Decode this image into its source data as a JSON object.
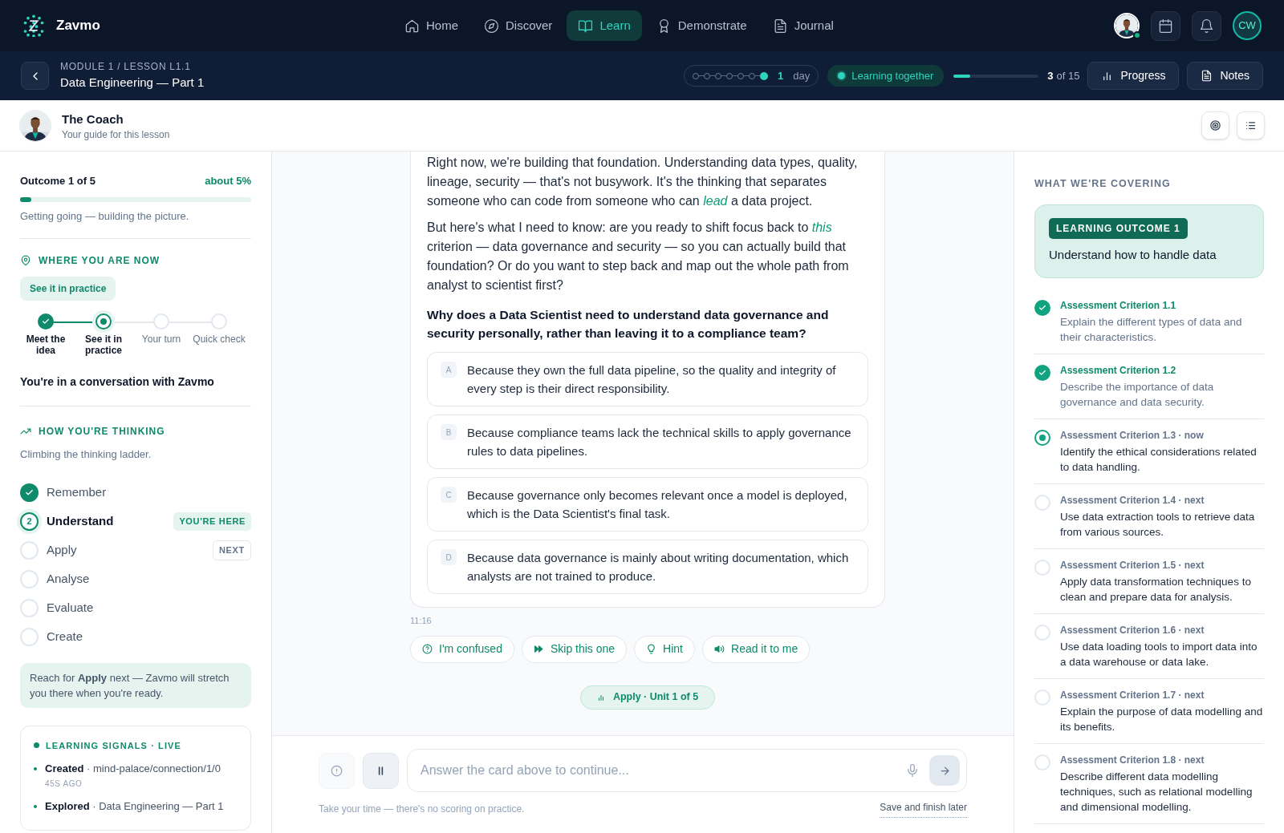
{
  "nav": {
    "brand": "Zavmo",
    "items": [
      {
        "label": "Home",
        "kind": "home",
        "selected": false
      },
      {
        "label": "Discover",
        "kind": "compass",
        "selected": false
      },
      {
        "label": "Learn",
        "kind": "book",
        "selected": true
      },
      {
        "label": "Demonstrate",
        "kind": "award",
        "selected": false
      },
      {
        "label": "Journal",
        "kind": "file",
        "selected": false
      }
    ],
    "online": true,
    "initials": "CW"
  },
  "lesson": {
    "breadcrumb": "MODULE 1 / LESSON L1.1",
    "title": "Data Engineering — Part 1",
    "streak": {
      "days": [
        {
          "active": false
        },
        {
          "active": false
        },
        {
          "active": false
        },
        {
          "active": false
        },
        {
          "active": false
        },
        {
          "active": false
        },
        {
          "active": true
        }
      ],
      "count": "1",
      "unit": "day"
    },
    "mode": "Learning together",
    "progress": {
      "level": 0.2,
      "current": "3",
      "total": "of 15"
    },
    "buttons": [
      {
        "label": "Progress",
        "kind": "bars"
      },
      {
        "label": "Notes",
        "kind": "file"
      }
    ]
  },
  "coach": {
    "name": "The Coach",
    "subtitle": "Your guide for this lesson"
  },
  "left": {
    "outcome": {
      "label": "Outcome 1 of 5",
      "percent": "about 5%",
      "level": 0.05,
      "caption": "Getting going — building the picture."
    },
    "where": {
      "heading": "WHERE YOU ARE NOW",
      "chip": "See it in practice",
      "steps": [
        {
          "label": "Meet the idea",
          "kind": "done"
        },
        {
          "label": "See it in practice",
          "kind": "current"
        },
        {
          "label": "Your turn",
          "kind": "todo"
        },
        {
          "label": "Quick check",
          "kind": "todo"
        }
      ],
      "status": "You're in a conversation with Zavmo"
    },
    "thinking": {
      "heading": "HOW YOU'RE THINKING",
      "caption": "Climbing the thinking ladder.",
      "levels": [
        {
          "label": "Remember",
          "kind": "done"
        },
        {
          "label": "Understand",
          "kind": "current",
          "number": "2",
          "badge": {
            "text": "YOU'RE HERE",
            "kind": "here"
          }
        },
        {
          "label": "Apply",
          "kind": "todo",
          "badge": {
            "text": "NEXT",
            "kind": "next"
          }
        },
        {
          "label": "Analyse",
          "kind": "todo"
        },
        {
          "label": "Evaluate",
          "kind": "todo"
        },
        {
          "label": "Create",
          "kind": "todo"
        }
      ],
      "note": "Reach for **Apply** next — Zavmo will stretch you there when you're ready."
    },
    "signals": {
      "heading": "LEARNING SIGNALS · LIVE",
      "items": [
        {
          "action": "Created",
          "detail": "· mind-palace/connection/1/0",
          "time": "45S AGO"
        },
        {
          "action": "Explored",
          "detail": "· Data Engineering — Part 1"
        }
      ]
    }
  },
  "chat": {
    "paragraphs": [
      "Right now, we're building that foundation. Understanding data types, quality, lineage, security — that's not busywork. It's the thinking that separates someone who can code from someone who can *lead* a data project.",
      "But here's what I need to know: are you ready to shift focus back to *this* criterion — data governance and security — so you can actually build that foundation? Or do you want to step back and map out the whole path from analyst to scientist first?"
    ],
    "question": "Why does a Data Scientist need to understand data governance and security personally, rather than leaving it to a compliance team?",
    "options": [
      {
        "letter": "A",
        "text": "Because they own the full data pipeline, so the quality and integrity of every step is their direct responsibility."
      },
      {
        "letter": "B",
        "text": "Because compliance teams lack the technical skills to apply governance rules to data pipelines."
      },
      {
        "letter": "C",
        "text": "Because governance only becomes relevant once a model is deployed, which is the Data Scientist's final task."
      },
      {
        "letter": "D",
        "text": "Because data governance is mainly about writing documentation, which analysts are not trained to produce."
      }
    ],
    "time": "11:16",
    "actions": [
      {
        "label": "I'm confused",
        "kind": "help"
      },
      {
        "label": "Skip this one",
        "kind": "ff"
      },
      {
        "label": "Hint",
        "kind": "bulb"
      },
      {
        "label": "Read it to me",
        "kind": "speaker"
      }
    ],
    "unit": "Apply · Unit 1 of 5",
    "composer": {
      "placeholder": "Answer the card above to continue...",
      "note": "Take your time — there's no scoring on practice.",
      "save": "Save and finish later"
    }
  },
  "right": {
    "heading": "WHAT WE'RE COVERING",
    "outcome_tag": "LEARNING OUTCOME 1",
    "outcome": "Understand how to handle data",
    "criteria": [
      {
        "title": "Assessment Criterion 1.1",
        "text": "Explain the different types of data and their characteristics.",
        "kind": "done"
      },
      {
        "title": "Assessment Criterion 1.2",
        "text": "Describe the importance of data governance and data security.",
        "kind": "done"
      },
      {
        "title": "Assessment Criterion 1.3 · now",
        "text": "Identify the ethical considerations related to data handling.",
        "kind": "current"
      },
      {
        "title": "Assessment Criterion 1.4 · next",
        "text": "Use data extraction tools to retrieve data from various sources.",
        "kind": "todo"
      },
      {
        "title": "Assessment Criterion 1.5 · next",
        "text": "Apply data transformation techniques to clean and prepare data for analysis.",
        "kind": "todo"
      },
      {
        "title": "Assessment Criterion 1.6 · next",
        "text": "Use data loading tools to import data into a data warehouse or data lake.",
        "kind": "todo"
      },
      {
        "title": "Assessment Criterion 1.7 · next",
        "text": "Explain the purpose of data modelling and its benefits.",
        "kind": "todo"
      },
      {
        "title": "Assessment Criterion 1.8 · next",
        "text": "Describe different data modelling techniques, such as relational modelling and dimensional modelling.",
        "kind": "todo"
      }
    ]
  }
}
